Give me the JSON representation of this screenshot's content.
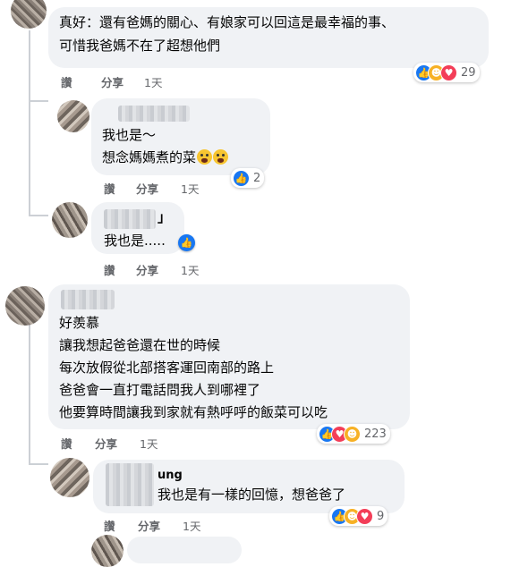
{
  "comment1": {
    "text_line1": "真好：還有爸媽的關心、有娘家可以回這是最幸福的事、",
    "text_line2": "可惜我爸媽不在了超想他們",
    "reply": "讚",
    "share": "分享",
    "time": "1天",
    "reaction_count": "29",
    "reaction_icons": [
      "like-icon",
      "care-icon",
      "heart-icon"
    ]
  },
  "reply1": {
    "text_line1": "我也是～",
    "text_line2": "想念媽媽煮的菜",
    "emoji": "crying-face-icon",
    "reply": "讚",
    "share": "分享",
    "time": "1天",
    "reaction_count": "2"
  },
  "reply2": {
    "name_suffix": "」",
    "text": "我也是.....",
    "reply": "讚",
    "share": "分享",
    "time": "1天"
  },
  "comment2": {
    "lines": [
      "好羨慕",
      "讓我想起爸爸還在世的時候",
      "每次放假從北部搭客運回南部的路上",
      "爸爸會一直打電話問我人到哪裡了",
      "他要算時間讓我到家就有熱呼呼的飯菜可以吃"
    ],
    "reply": "讚",
    "share": "分享",
    "time": "1天",
    "reaction_count": "223"
  },
  "reply3": {
    "name": "ung",
    "text": "我也是有一樣的回憶，想爸爸了",
    "reply": "讚",
    "share": "分享",
    "time": "1天",
    "reaction_count": "9"
  },
  "colors": {
    "bubble": "#f0f2f5",
    "like": "#1877f2",
    "heart": "#f33e58",
    "care": "#f7b125",
    "meta": "#65676b"
  }
}
